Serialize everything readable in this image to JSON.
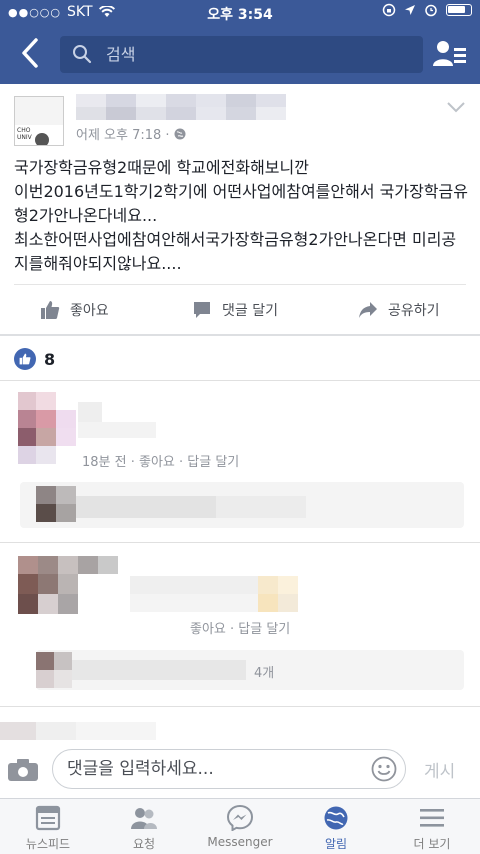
{
  "status_bar": {
    "signal": "●●○○○",
    "carrier": "SKT",
    "time": "오후 3:54"
  },
  "search": {
    "placeholder": "검색"
  },
  "post": {
    "timestamp": "어제 오후 7:18 · ",
    "lines": [
      "국가장학금유형2때문에 학교에전화해보니깐",
      "이번2016년도1학기2학기에 어떤사업에참여를안해서 국가장학금유형2가안나온다네요...",
      "최소한어떤사업에참여안해서국가장학금유형2가안나온다면 미리공지를해줘야되지않나요...."
    ]
  },
  "actions": {
    "like": "좋아요",
    "comment": "댓글 달기",
    "share": "공유하기"
  },
  "likes_count": "8",
  "comments": {
    "first_meta": "18분 전 · 좋아요 · 답글 달기",
    "second_meta": "좋아요 · 답글 달기",
    "replies_count": "4개"
  },
  "composer": {
    "placeholder": "댓글을 입력하세요...",
    "post_label": "게시"
  },
  "tabs": [
    {
      "label": "뉴스피드",
      "icon": "news-feed-icon"
    },
    {
      "label": "요청",
      "icon": "friend-requests-icon"
    },
    {
      "label": "Messenger",
      "icon": "messenger-icon"
    },
    {
      "label": "알림",
      "icon": "globe-notifications-icon"
    },
    {
      "label": "더 보기",
      "icon": "menu-icon"
    }
  ],
  "colors": {
    "brand": "#3b5998",
    "link_blue": "#4267b2",
    "muted_text": "#90949c"
  }
}
